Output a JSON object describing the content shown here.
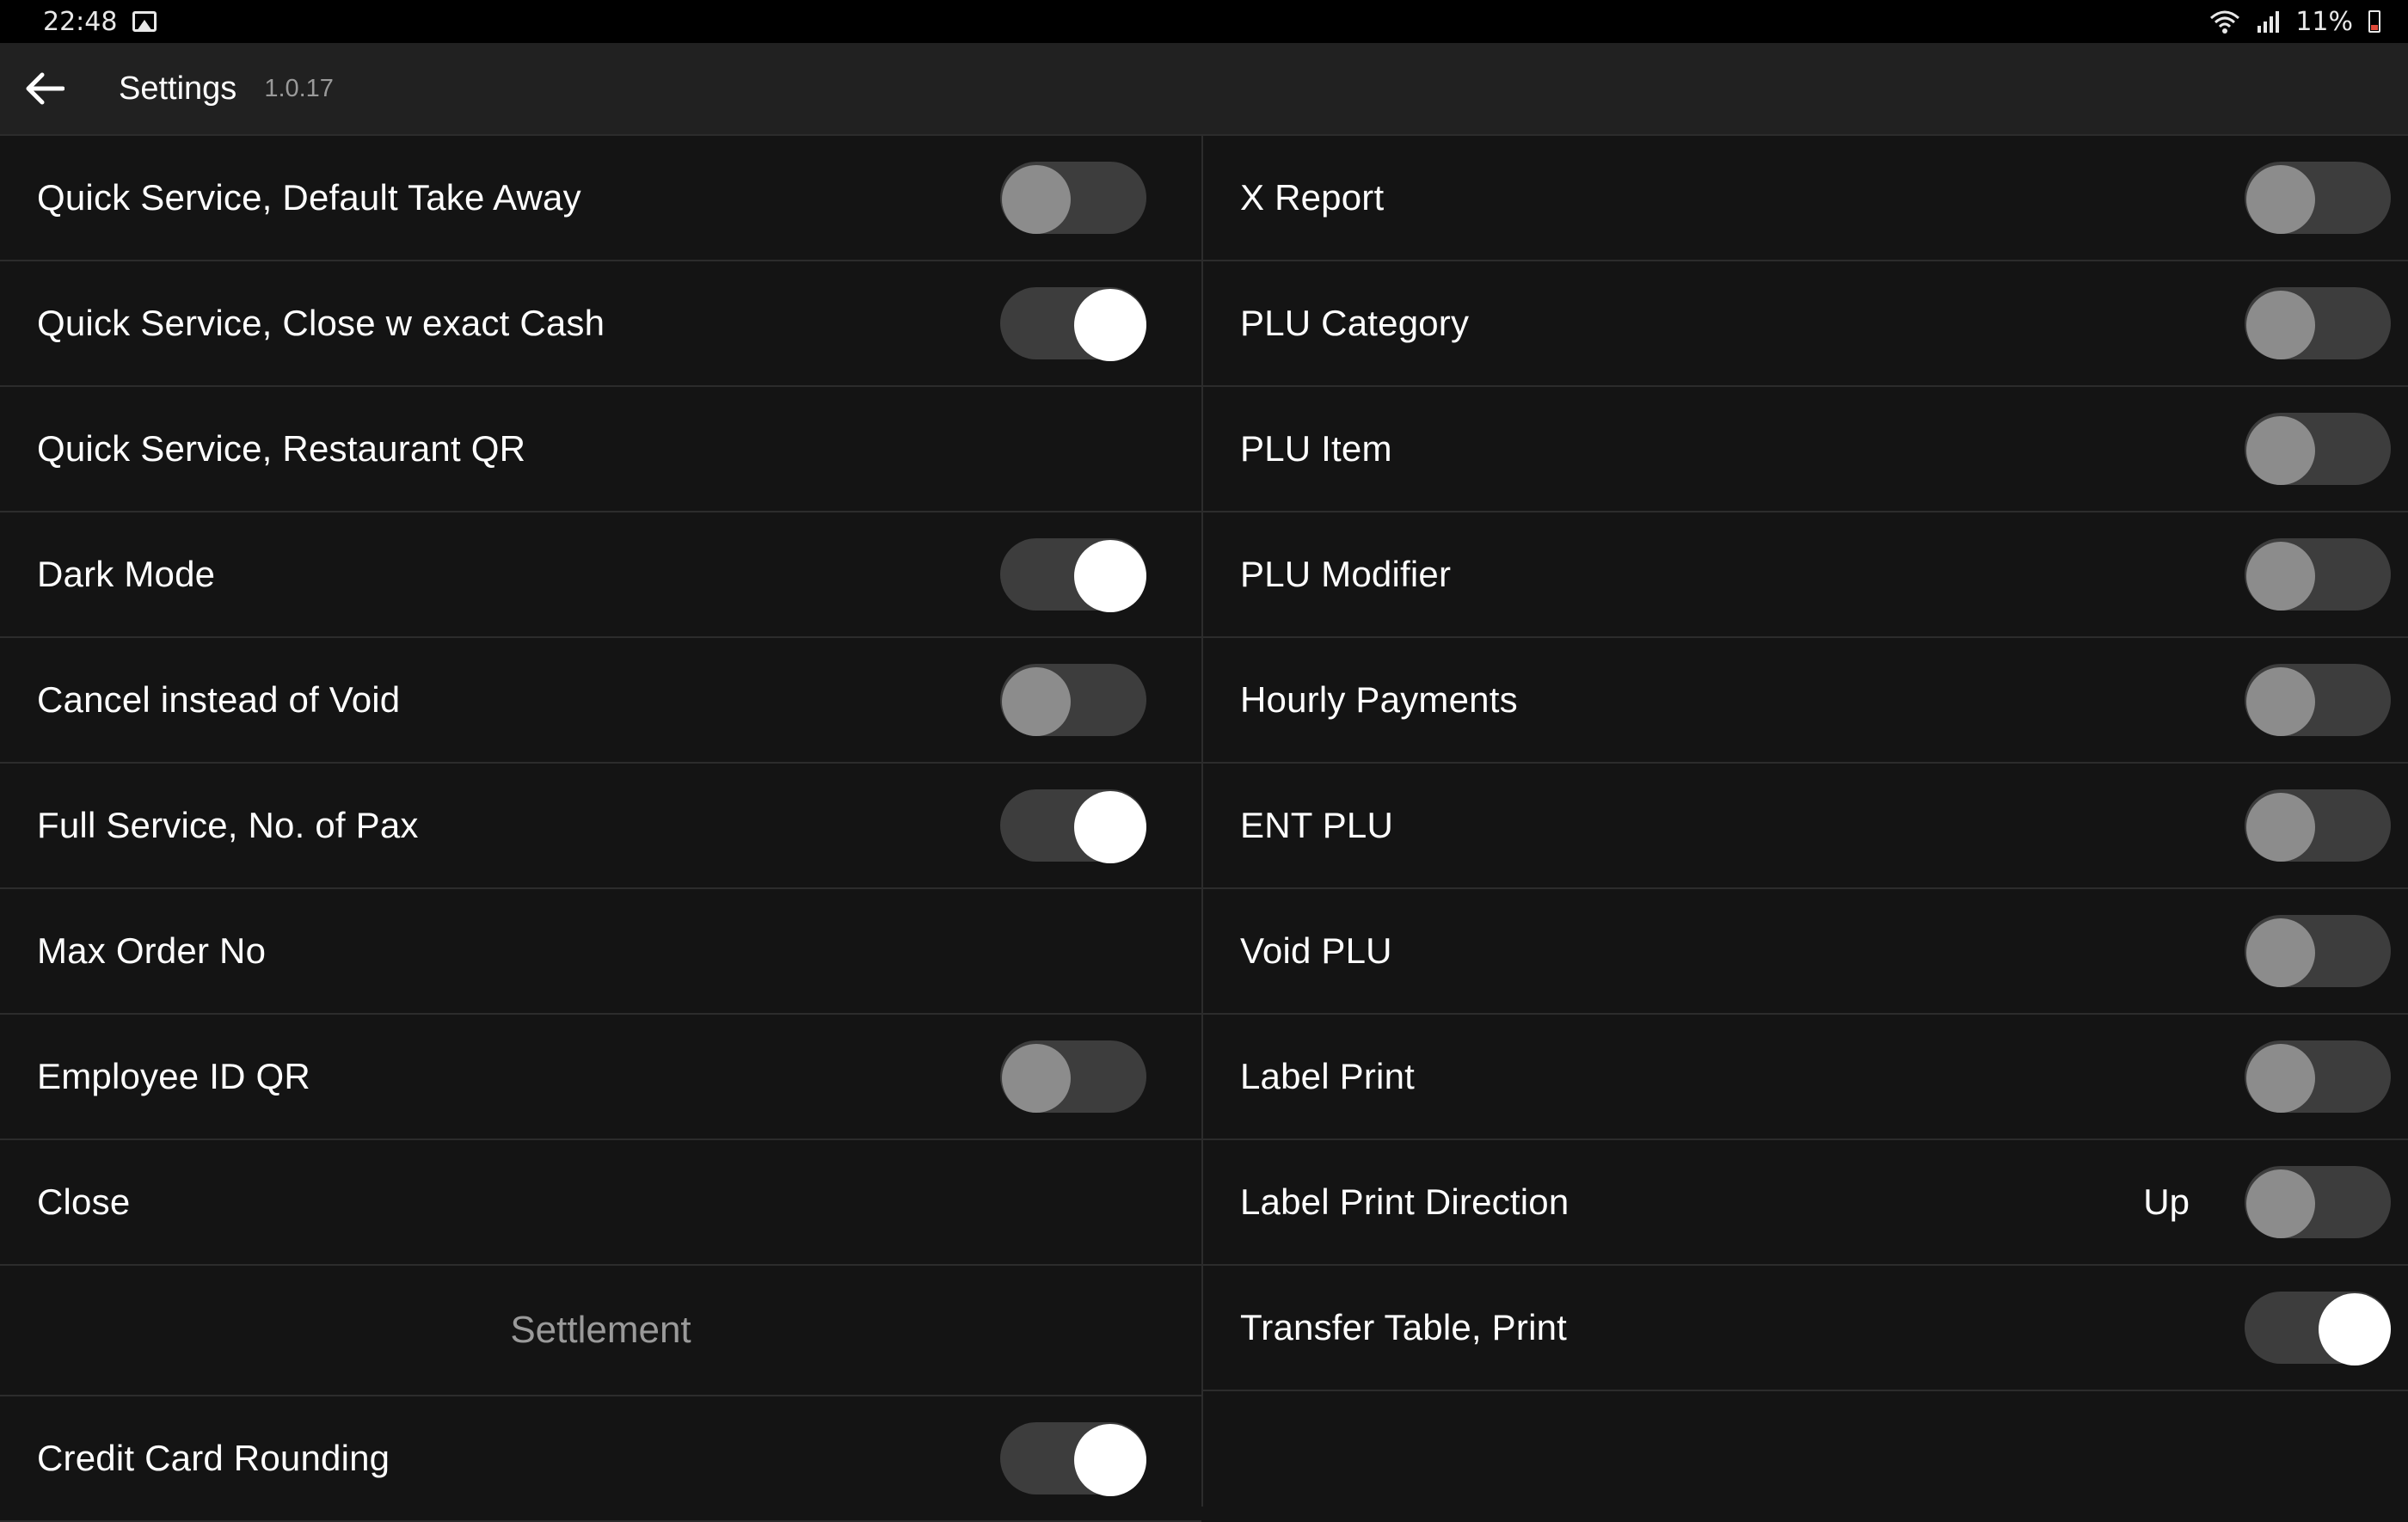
{
  "status_bar": {
    "time": "22:48",
    "battery": "11%"
  },
  "app_bar": {
    "title": "Settings",
    "version": "1.0.17"
  },
  "left_column": [
    {
      "label": "Quick Service, Default Take Away",
      "toggle": "off"
    },
    {
      "label": "Quick Service, Close w exact Cash",
      "toggle": "on"
    },
    {
      "label": "Quick Service, Restaurant QR",
      "toggle": null
    },
    {
      "label": "Dark Mode",
      "toggle": "on"
    },
    {
      "label": "Cancel instead of Void",
      "toggle": "off"
    },
    {
      "label": "Full Service, No. of Pax",
      "toggle": "on"
    },
    {
      "label": "Max Order No",
      "toggle": null
    },
    {
      "label": "Employee ID QR",
      "toggle": "off"
    },
    {
      "label": "Close",
      "toggle": null
    }
  ],
  "section": {
    "label": "Settlement"
  },
  "left_column_after_section": [
    {
      "label": "Credit Card Rounding",
      "toggle": "on"
    }
  ],
  "right_column": [
    {
      "label": "X Report",
      "toggle": "off"
    },
    {
      "label": "PLU Category",
      "toggle": "off"
    },
    {
      "label": "PLU Item",
      "toggle": "off"
    },
    {
      "label": "PLU Modifier",
      "toggle": "off"
    },
    {
      "label": "Hourly Payments",
      "toggle": "off"
    },
    {
      "label": "ENT PLU",
      "toggle": "off"
    },
    {
      "label": "Void PLU",
      "toggle": "off"
    },
    {
      "label": "Label Print",
      "toggle": "off"
    },
    {
      "label": "Label Print Direction",
      "value": "Up",
      "toggle": "off"
    },
    {
      "label": "Transfer Table, Print",
      "toggle": "on"
    }
  ],
  "colors": {
    "background": "#141414",
    "app_bar": "#212121",
    "divider": "#2c2c2c",
    "toggle_track": "#3d3d3d",
    "toggle_knob_off": "#8c8c8c",
    "toggle_knob_on": "#ffffff",
    "section_text": "#9a9a9a"
  },
  "icons": {
    "back": "arrow-left-icon",
    "gallery": "image-icon",
    "wifi": "wifi-icon",
    "signal": "signal-icon",
    "battery": "battery-icon"
  }
}
